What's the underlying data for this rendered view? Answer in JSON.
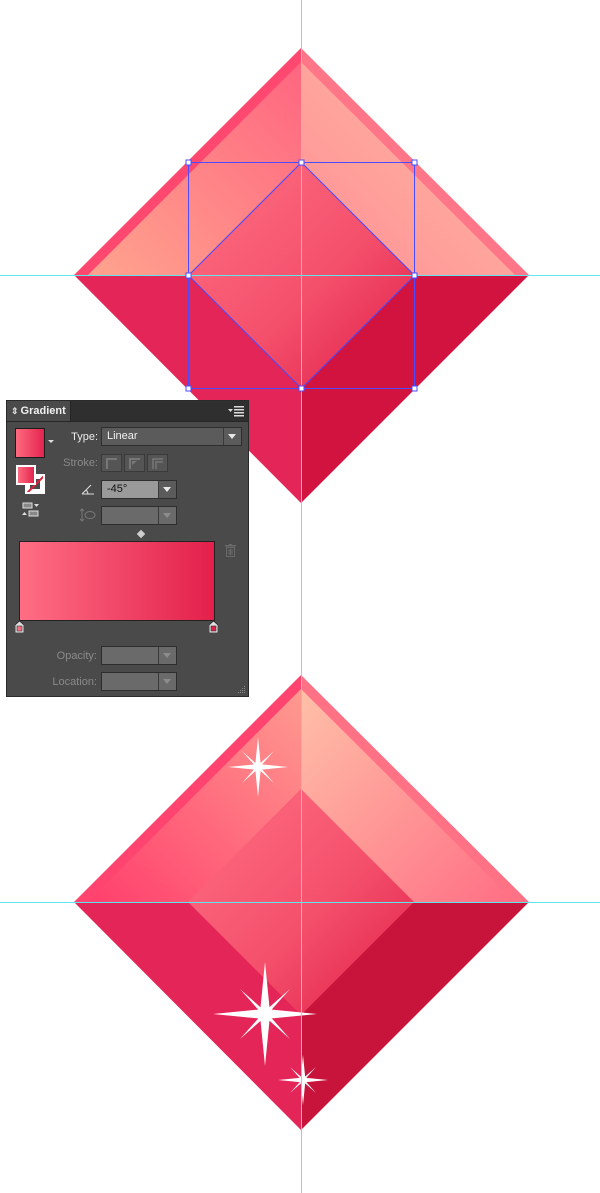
{
  "canvas": {
    "background": "#ffffff",
    "guide_color": "#5ee8ee",
    "selection_color": "#4b4bff",
    "gem_top": {
      "label": "ruby gem - selected (gradient being edited)",
      "selected": true
    },
    "gem_bottom": {
      "label": "ruby gem - finished with sparkles",
      "sparkle_count": 3
    },
    "gem_colors": {
      "left_bevel": "#ff4870",
      "right_bevel": "#ff7688",
      "upper_left_facet_from": "#ffa38e",
      "upper_left_facet_to": "#ff6680",
      "upper_right_facet_from": "#ffbba3",
      "upper_right_facet_to": "#ff8f95",
      "table_from": "#ff6a80",
      "table_to": "#e2254e",
      "lower_left": "#e32557",
      "lower_right": "#d3133f"
    }
  },
  "gradient_panel": {
    "title": "Gradient",
    "menu_icon": "panel-menu-icon",
    "type_label": "Type:",
    "type_value": "Linear",
    "stroke_label": "Stroke:",
    "angle_value": "-45°",
    "aspect_value": "",
    "opacity_label": "Opacity:",
    "opacity_value": "",
    "location_label": "Location:",
    "location_value": "",
    "ramp": {
      "start_color": "#ff6e84",
      "end_color": "#e3204b",
      "stops": [
        {
          "location_pct": 0,
          "color": "#ff6e84"
        },
        {
          "location_pct": 100,
          "color": "#e3204b"
        }
      ],
      "midpoint_pct": 50
    }
  }
}
